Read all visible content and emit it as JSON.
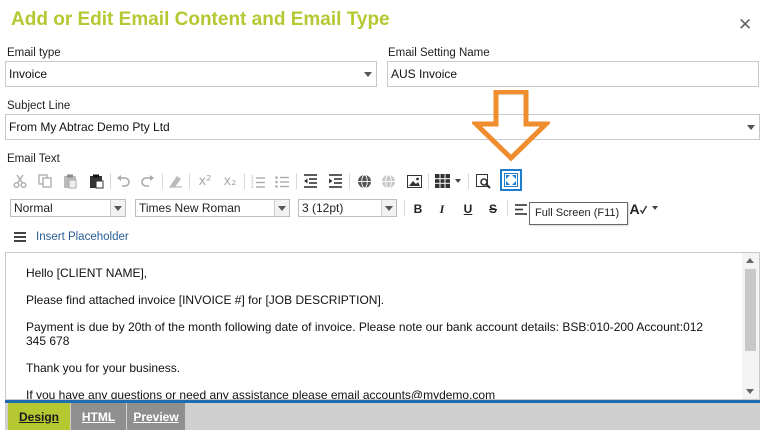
{
  "dialog": {
    "title": "Add or Edit Email Content and Email Type",
    "close_glyph": "✕"
  },
  "form": {
    "email_type_label": "Email type",
    "email_type_value": "Invoice",
    "email_setting_name_label": "Email Setting Name",
    "email_setting_name_value": "AUS Invoice",
    "subject_line_label": "Subject Line",
    "subject_line_value": "From My Abtrac Demo Pty Ltd",
    "email_text_label": "Email Text"
  },
  "toolbar": {
    "icons": [
      "cut-icon",
      "copy-icon",
      "paste-icon",
      "paste-word-icon",
      "undo-icon",
      "redo-icon",
      "format-stripper-icon",
      "superscript-icon",
      "subscript-icon",
      "ordered-list-icon",
      "unordered-list-icon",
      "outdent-icon",
      "indent-icon",
      "hyperlink-icon",
      "unlink-icon",
      "image-icon",
      "table-icon",
      "find-icon",
      "fullscreen-icon"
    ],
    "superscript_glyph": "x²",
    "subscript_glyph": "x₂",
    "paragraph_style": "Normal",
    "font_name": "Times New Roman",
    "font_size": "3 (12pt)",
    "bold": "B",
    "italic": "I",
    "underline": "U",
    "strike": "S",
    "tooltip": "Full Screen (F11)",
    "spellcheck_glyph": "A"
  },
  "insert_placeholder_label": "Insert Placeholder",
  "editor": {
    "paragraphs": [
      "Hello [CLIENT NAME],",
      "Please find attached invoice [INVOICE #] for [JOB DESCRIPTION].",
      "Payment is due by 20th of the month following date of invoice. Please note our bank account details: BSB:010-200 Account:012 345 678",
      "Thank you for your business.",
      "If you have any questions or need any assistance please email accounts@mydemo.com"
    ]
  },
  "modes": {
    "design": "Design",
    "html": "HTML",
    "preview": "Preview"
  },
  "colors": {
    "title": "#b5c832",
    "arrow": "#ef8c2e",
    "accent_blue": "#1f6cb0",
    "active_tab": "#b5c832"
  }
}
